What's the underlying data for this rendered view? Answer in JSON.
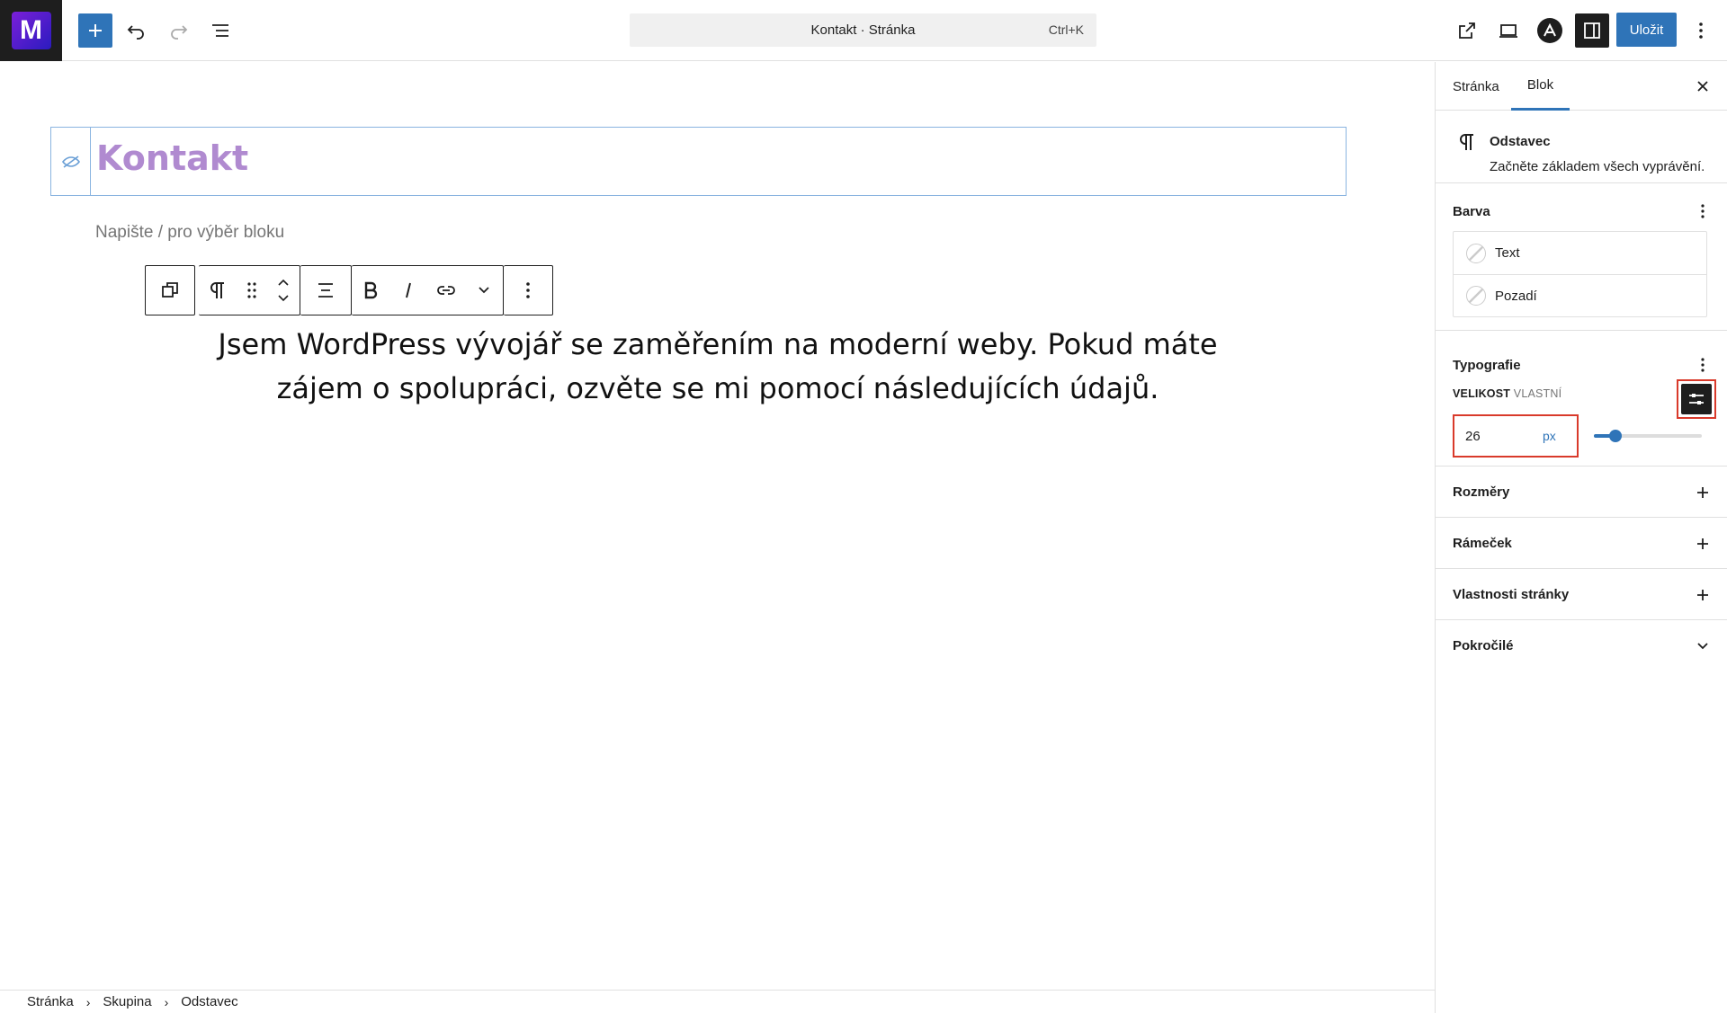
{
  "topbar": {
    "logo_letter": "M",
    "command_title": "Kontakt · Stránka",
    "command_shortcut": "Ctrl+K",
    "save_label": "Uložit"
  },
  "editor": {
    "page_title": "Kontakt",
    "placeholder": "Napište / pro výběr bloku",
    "paragraph": "Jsem WordPress vývojář se zaměřením na moderní weby. Pokud máte zájem o spolupráci, ozvěte se mi pomocí následujících údajů."
  },
  "breadcrumb": [
    "Stránka",
    "Skupina",
    "Odstavec"
  ],
  "sidebar": {
    "tabs": [
      "Stránka",
      "Blok"
    ],
    "active_tab": "Blok",
    "block_name": "Odstavec",
    "block_description": "Začněte základem všech vyprávění.",
    "color": {
      "title": "Barva",
      "items": [
        "Text",
        "Pozadí"
      ]
    },
    "typography": {
      "title": "Typografie",
      "size_label": "VELIKOST",
      "size_sublabel": "VLASTNÍ",
      "size_value": "26",
      "size_unit": "px",
      "slider_fraction": 0.2
    },
    "panels": [
      "Rozměry",
      "Rámeček",
      "Vlastnosti stránky",
      "Pokročilé"
    ]
  },
  "colors": {
    "accent": "#2f74b8",
    "highlight": "#d93a2b",
    "title": "#b08ad0"
  }
}
